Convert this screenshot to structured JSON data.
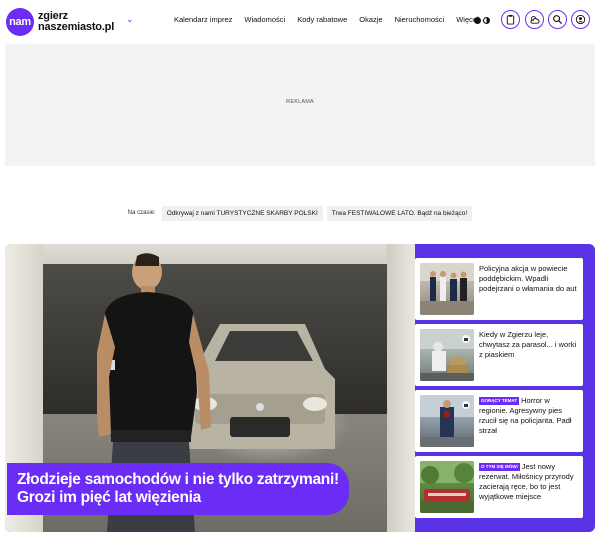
{
  "header": {
    "logo": {
      "badge": "nam",
      "line1": "zgierz",
      "line2": "naszemiasto.pl"
    },
    "nav": [
      {
        "label": "Kalendarz imprez"
      },
      {
        "label": "Wiadomości"
      },
      {
        "label": "Kody rabatowe"
      },
      {
        "label": "Okazje"
      },
      {
        "label": "Nieruchomości"
      },
      {
        "label": "Więcej"
      }
    ],
    "icons": [
      "theme-toggle-icon",
      "clipboard-icon",
      "weather-icon",
      "search-icon",
      "user-icon"
    ],
    "accent": "#6b2cf5"
  },
  "ad": {
    "label": "REKLAMA"
  },
  "now": {
    "label": "Na czasie:",
    "chips": [
      "Odkrywaj z nami TURYSTYCZNE SKARBY POLSKI",
      "Trwa FESTIWALOWE LATO. Bądź na bieżąco!"
    ]
  },
  "hero": {
    "title": "Złodzieje samochodów i nie tylko zatrzymani! Grozi im pięć lat więzienia"
  },
  "side": [
    {
      "badge": "",
      "text": "Policyjna akcja w powiecie poddębickim. Wpadli podejrzani o włamania do aut",
      "icon": ""
    },
    {
      "badge": "",
      "text": "Kiedy w Zgierzu leje, chwytasz za parasol... i worki z piaskiem",
      "icon": "camera-icon"
    },
    {
      "badge": "GORĄCY TEMAT",
      "text": "Horror w regionie. Agresywny pies rzucił się na policjanta. Padł strzał",
      "icon": "camera-icon"
    },
    {
      "badge": "O TYM SIĘ MÓWI",
      "text": "Jest nowy rezerwat. Miłośnicy przyrody zacierają ręce, bo to jest wyjątkowe miejsce",
      "icon": ""
    }
  ]
}
